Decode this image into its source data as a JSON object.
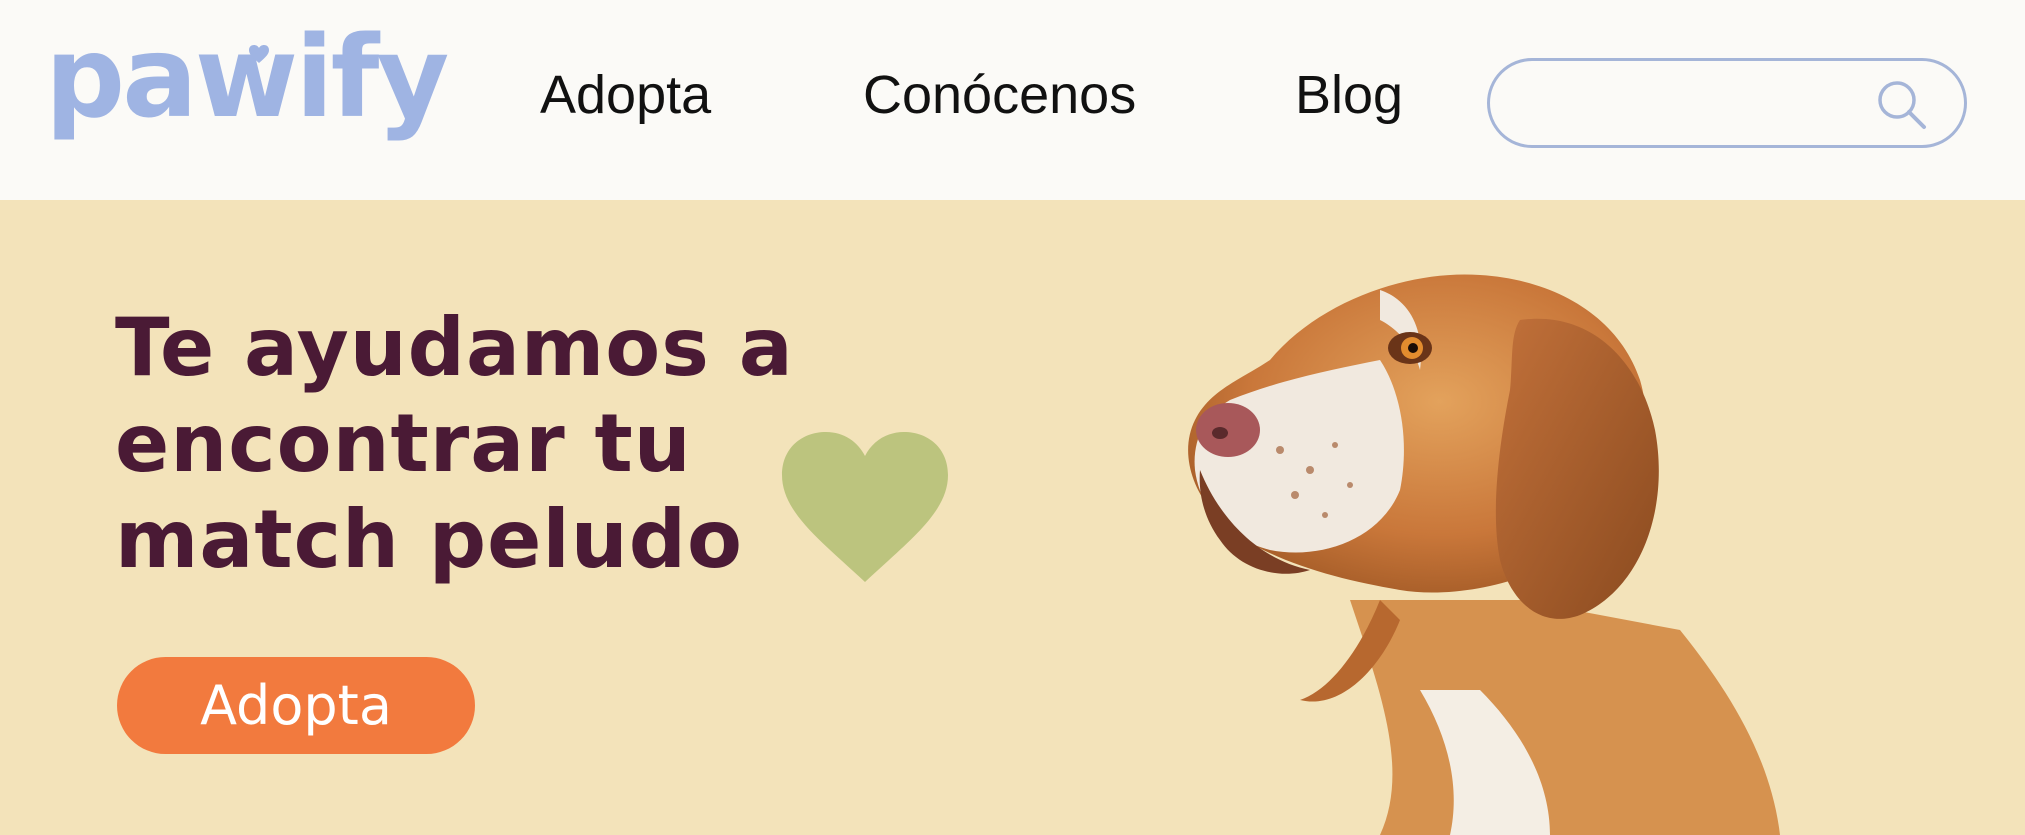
{
  "brand": {
    "logo_text": "pawify",
    "logo_color": "#9fb4e3"
  },
  "nav": {
    "items": [
      {
        "label": "Adopta"
      },
      {
        "label": "Conócenos"
      },
      {
        "label": "Blog"
      }
    ]
  },
  "search": {
    "value": "",
    "placeholder": "",
    "icon": "search-icon"
  },
  "hero": {
    "title_lines": [
      "Te ayudamos a",
      "encontrar tu",
      "match peludo"
    ],
    "cta_label": "Adopta",
    "decoration_icon": "heart-icon",
    "image": "beagle-dog-photo"
  },
  "colors": {
    "header_bg": "#fbfaf7",
    "hero_bg": "#f3e3ba",
    "title": "#4a1a35",
    "cta": "#f27a3e",
    "heart": "#bcc47e",
    "search_border": "#a5b5d8"
  }
}
